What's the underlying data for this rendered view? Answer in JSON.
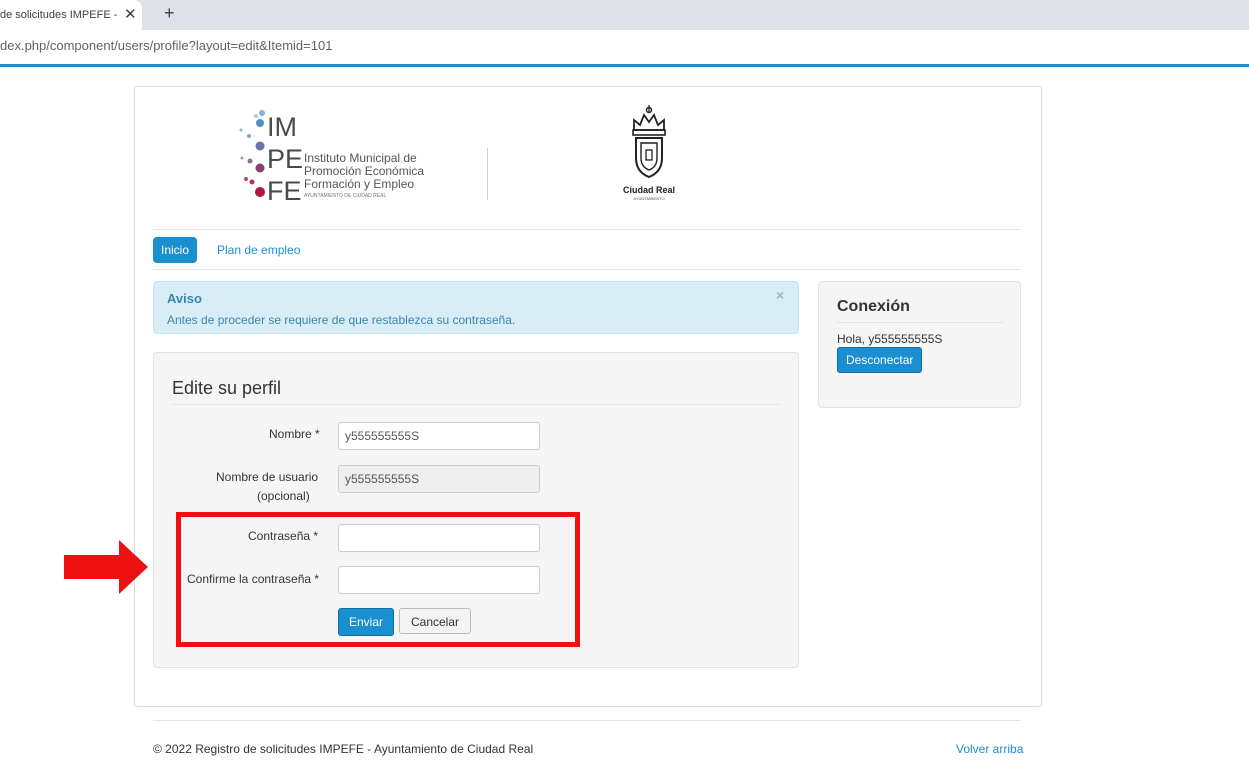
{
  "browser": {
    "tab_title": "de solicitudes IMPEFE - ",
    "tab_close": "✕",
    "new_tab": "+",
    "url": "dex.php/component/users/profile?layout=edit&Itemid=101"
  },
  "header": {
    "impefe_logo": {
      "letters": [
        "IM",
        "PE",
        "FE"
      ],
      "lines": [
        "Instituto Municipal de",
        "Promoción Económica",
        "Formación y Empleo"
      ],
      "sub": "AYUNTAMIENTO DE CIUDAD REAL"
    },
    "city_logo": {
      "name": "Ciudad Real",
      "sub": "AYUNTAMIENTO"
    }
  },
  "nav": {
    "items": [
      {
        "label": "Inicio",
        "active": true
      },
      {
        "label": "Plan de empleo",
        "active": false
      }
    ]
  },
  "alert": {
    "heading": "Aviso",
    "message": "Antes de proceder se requiere de que restablezca su contraseña.",
    "close": "×"
  },
  "form": {
    "legend": "Edite su perfil",
    "fields": {
      "name": {
        "label": "Nombre *",
        "value": "y555555555S"
      },
      "username": {
        "label_line1": "Nombre de usuario",
        "label_line2": "(opcional)",
        "value": "y555555555S"
      },
      "password": {
        "label": "Contraseña *",
        "value": ""
      },
      "password_confirm": {
        "label": "Confirme la contraseña *",
        "value": ""
      }
    },
    "submit": "Enviar",
    "cancel": "Cancelar"
  },
  "sidebar": {
    "title": "Conexión",
    "greeting": "Hola, y555555555S",
    "logout": "Desconectar"
  },
  "footer": {
    "copyright": "© 2022 Registro de solicitudes IMPEFE - Ayuntamiento de Ciudad Real",
    "back_to_top": "Volver arriba"
  },
  "colors": {
    "primary": "#1a8fcf",
    "alert_bg": "#d9edf7",
    "highlight": "#ee1111"
  }
}
